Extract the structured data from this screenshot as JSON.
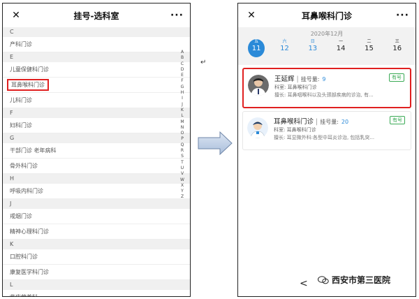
{
  "left": {
    "title": "挂号-选科室",
    "sections": [
      {
        "letter": "C",
        "items": [
          "产科门诊"
        ]
      },
      {
        "letter": "E",
        "items": [
          "儿童保健科门诊",
          "耳鼻喉科门诊",
          "儿科门诊"
        ]
      },
      {
        "letter": "F",
        "items": [
          "妇科门诊"
        ]
      },
      {
        "letter": "G",
        "items": [
          "干部门诊 老年病科",
          "骨外科门诊"
        ]
      },
      {
        "letter": "H",
        "items": [
          "呼吸内科门诊"
        ]
      },
      {
        "letter": "J",
        "items": [
          "戒烟门诊",
          "精神心理科门诊"
        ]
      },
      {
        "letter": "K",
        "items": [
          "口腔科门诊",
          "康复医学科门诊"
        ]
      },
      {
        "letter": "L",
        "items": [
          "临床营养科"
        ]
      }
    ],
    "alphabet": "ABCDEFGHIJKLMNOPQRSTUVWXYZ",
    "highlighted_item": "耳鼻喉科门诊"
  },
  "right": {
    "title": "耳鼻喉科门诊",
    "month": "2020年12月",
    "days": [
      {
        "wk": "五",
        "dt": "11"
      },
      {
        "wk": "六",
        "dt": "12"
      },
      {
        "wk": "日",
        "dt": "13"
      },
      {
        "wk": "一",
        "dt": "14"
      },
      {
        "wk": "二",
        "dt": "15"
      },
      {
        "wk": "三",
        "dt": "16"
      }
    ],
    "cards": [
      {
        "name": "王延辉",
        "count_label": "挂号量:",
        "count": "9",
        "dept": "科室: 耳鼻喉科门诊",
        "spec": "擅长: 耳鼻咽喉科以及头颈部疾病的诊治, 有...",
        "badge": "有号"
      },
      {
        "name": "耳鼻喉科门诊",
        "count_label": "挂号量:",
        "count": "20",
        "dept": "科室: 耳鼻喉科门诊",
        "spec": "擅长: 耳显微外科:各型中耳炎诊治, 包括乳突...",
        "badge": "有号"
      }
    ],
    "back": "<"
  },
  "watermark": "西安市第三医院",
  "colors": {
    "accent": "#2b8ad8",
    "highlight": "#e02020",
    "badge": "#3aaa55"
  }
}
